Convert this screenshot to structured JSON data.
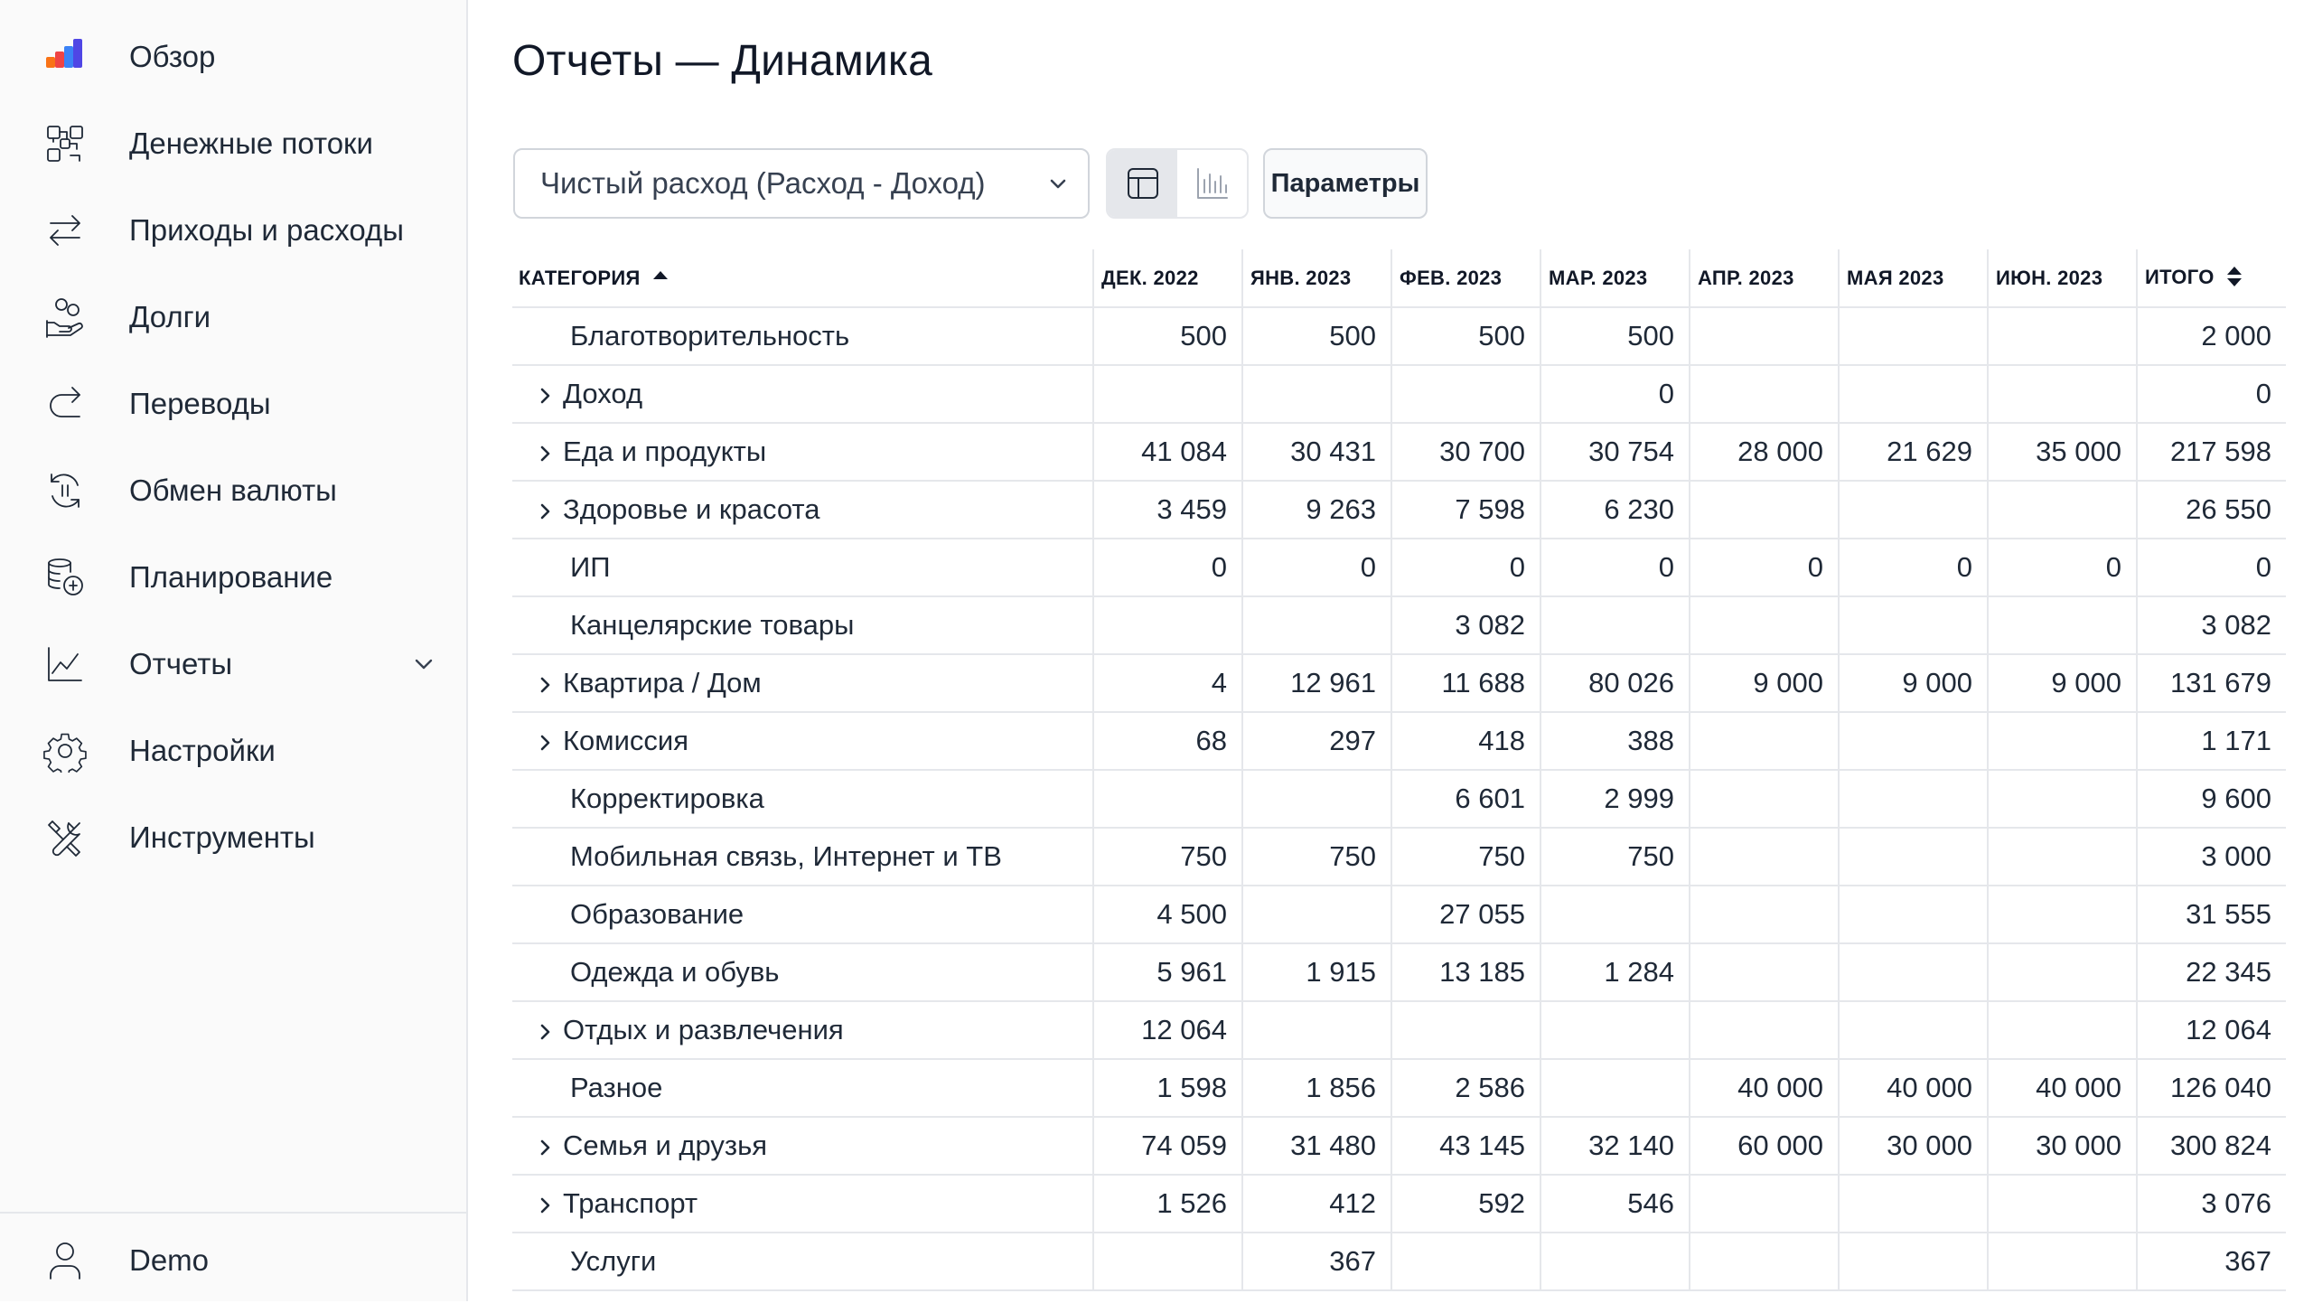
{
  "sidebar": {
    "items": [
      {
        "label": "Обзор",
        "icon": "overview-bars-icon"
      },
      {
        "label": "Денежные потоки",
        "icon": "cashflow-icon"
      },
      {
        "label": "Приходы и расходы",
        "icon": "arrows-exchange-icon"
      },
      {
        "label": "Долги",
        "icon": "debt-hand-coins-icon"
      },
      {
        "label": "Переводы",
        "icon": "transfer-arrow-icon"
      },
      {
        "label": "Обмен валюты",
        "icon": "currency-exchange-icon"
      },
      {
        "label": "Планирование",
        "icon": "coins-stack-icon"
      },
      {
        "label": "Отчеты",
        "icon": "chart-line-icon",
        "expanded_indicator": "chevron-down"
      },
      {
        "label": "Настройки",
        "icon": "gear-icon"
      },
      {
        "label": "Инструменты",
        "icon": "tools-icon"
      }
    ],
    "user": {
      "label": "Demo",
      "icon": "user-icon"
    }
  },
  "page": {
    "title": "Отчеты — Динамика"
  },
  "toolbar": {
    "select_value": "Чистый расход (Расход - Доход)",
    "view_modes": [
      {
        "name": "table",
        "icon": "table-icon",
        "active": true
      },
      {
        "name": "chart",
        "icon": "bar-chart-icon",
        "active": false
      }
    ],
    "params_label": "Параметры"
  },
  "table": {
    "headers": {
      "category": "КАТЕГОРИЯ",
      "months": [
        "ДЕК. 2022",
        "ЯНВ. 2023",
        "ФЕВ. 2023",
        "МАР. 2023",
        "АПР. 2023",
        "МАЯ 2023",
        "ИЮН. 2023"
      ],
      "total": "ИТОГО"
    },
    "rows": [
      {
        "category": "Благотворительность",
        "expandable": false,
        "values": [
          "500",
          "500",
          "500",
          "500",
          "",
          "",
          ""
        ],
        "total": "2 000"
      },
      {
        "category": "Доход",
        "expandable": true,
        "values": [
          "",
          "",
          "",
          "0",
          "",
          "",
          ""
        ],
        "total": "0"
      },
      {
        "category": "Еда и продукты",
        "expandable": true,
        "values": [
          "41 084",
          "30 431",
          "30 700",
          "30 754",
          "28 000",
          "21 629",
          "35 000"
        ],
        "total": "217 598"
      },
      {
        "category": "Здоровье и красота",
        "expandable": true,
        "values": [
          "3 459",
          "9 263",
          "7 598",
          "6 230",
          "",
          "",
          ""
        ],
        "total": "26 550"
      },
      {
        "category": "ИП",
        "expandable": false,
        "values": [
          "0",
          "0",
          "0",
          "0",
          "0",
          "0",
          "0"
        ],
        "total": "0"
      },
      {
        "category": "Канцелярские товары",
        "expandable": false,
        "values": [
          "",
          "",
          "3 082",
          "",
          "",
          "",
          ""
        ],
        "total": "3 082"
      },
      {
        "category": "Квартира / Дом",
        "expandable": true,
        "values": [
          "4",
          "12 961",
          "11 688",
          "80 026",
          "9 000",
          "9 000",
          "9 000"
        ],
        "total": "131 679"
      },
      {
        "category": "Комиссия",
        "expandable": true,
        "values": [
          "68",
          "297",
          "418",
          "388",
          "",
          "",
          ""
        ],
        "total": "1 171"
      },
      {
        "category": "Корректировка",
        "expandable": false,
        "values": [
          "",
          "",
          "6 601",
          "2 999",
          "",
          "",
          ""
        ],
        "total": "9 600"
      },
      {
        "category": "Мобильная связь, Интернет и ТВ",
        "expandable": false,
        "values": [
          "750",
          "750",
          "750",
          "750",
          "",
          "",
          ""
        ],
        "total": "3 000"
      },
      {
        "category": "Образование",
        "expandable": false,
        "values": [
          "4 500",
          "",
          "27 055",
          "",
          "",
          "",
          ""
        ],
        "total": "31 555"
      },
      {
        "category": "Одежда и обувь",
        "expandable": false,
        "values": [
          "5 961",
          "1 915",
          "13 185",
          "1 284",
          "",
          "",
          ""
        ],
        "total": "22 345"
      },
      {
        "category": "Отдых и развлечения",
        "expandable": true,
        "values": [
          "12 064",
          "",
          "",
          "",
          "",
          "",
          ""
        ],
        "total": "12 064"
      },
      {
        "category": "Разное",
        "expandable": false,
        "values": [
          "1 598",
          "1 856",
          "2 586",
          "",
          "40 000",
          "40 000",
          "40 000"
        ],
        "total": "126 040"
      },
      {
        "category": "Семья и друзья",
        "expandable": true,
        "values": [
          "74 059",
          "31 480",
          "43 145",
          "32 140",
          "60 000",
          "30 000",
          "30 000"
        ],
        "total": "300 824"
      },
      {
        "category": "Транспорт",
        "expandable": true,
        "values": [
          "1 526",
          "412",
          "592",
          "546",
          "",
          "",
          ""
        ],
        "total": "3 076"
      },
      {
        "category": "Услуги",
        "expandable": false,
        "values": [
          "",
          "367",
          "",
          "",
          "",
          "",
          ""
        ],
        "total": "367"
      }
    ]
  },
  "colors": {
    "sidebar_bg": "#fafafa",
    "border": "#e5e7eb",
    "text": "#1f2937",
    "logo_orange": "#f97316",
    "logo_red": "#ef4444",
    "logo_blue": "#3b82f6",
    "logo_indigo": "#4f46e5"
  }
}
